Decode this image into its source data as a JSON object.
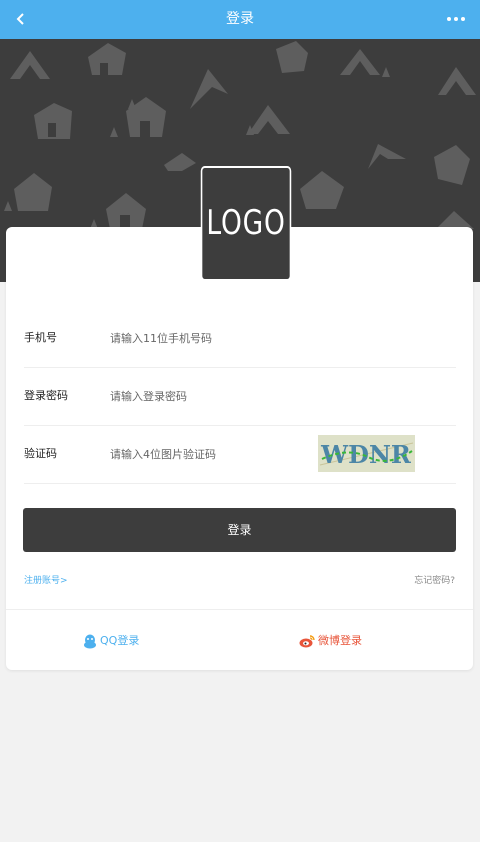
{
  "header": {
    "title": "登录",
    "back_icon": "chevron-left-icon",
    "more_icon": "more-dots-icon",
    "color": "#4db0ee"
  },
  "hero": {
    "background": "#3d3d3d",
    "pattern": "house-and-tree-icons"
  },
  "logo": {
    "text": "LOGO"
  },
  "form": {
    "phone": {
      "label": "手机号",
      "placeholder": "请输入11位手机号码"
    },
    "password": {
      "label": "登录密码",
      "placeholder": "请输入登录密码"
    },
    "captcha": {
      "label": "验证码",
      "placeholder": "请输入4位图片验证码",
      "image_text": "WDNR"
    }
  },
  "actions": {
    "login_label": "登录",
    "register_label": "注册账号>",
    "forgot_label": "忘记密码?"
  },
  "social": {
    "qq_label": "QQ登录",
    "weibo_label": "微博登录",
    "qq_color": "#4db0ee",
    "weibo_color": "#e8553a"
  }
}
